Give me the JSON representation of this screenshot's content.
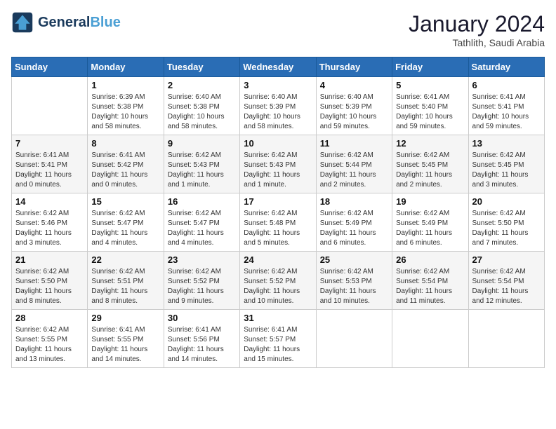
{
  "header": {
    "logo_line1": "General",
    "logo_line2": "Blue",
    "month": "January 2024",
    "location": "Tathlith, Saudi Arabia"
  },
  "weekdays": [
    "Sunday",
    "Monday",
    "Tuesday",
    "Wednesday",
    "Thursday",
    "Friday",
    "Saturday"
  ],
  "weeks": [
    [
      {
        "day": "",
        "info": ""
      },
      {
        "day": "1",
        "info": "Sunrise: 6:39 AM\nSunset: 5:38 PM\nDaylight: 10 hours\nand 58 minutes."
      },
      {
        "day": "2",
        "info": "Sunrise: 6:40 AM\nSunset: 5:38 PM\nDaylight: 10 hours\nand 58 minutes."
      },
      {
        "day": "3",
        "info": "Sunrise: 6:40 AM\nSunset: 5:39 PM\nDaylight: 10 hours\nand 58 minutes."
      },
      {
        "day": "4",
        "info": "Sunrise: 6:40 AM\nSunset: 5:39 PM\nDaylight: 10 hours\nand 59 minutes."
      },
      {
        "day": "5",
        "info": "Sunrise: 6:41 AM\nSunset: 5:40 PM\nDaylight: 10 hours\nand 59 minutes."
      },
      {
        "day": "6",
        "info": "Sunrise: 6:41 AM\nSunset: 5:41 PM\nDaylight: 10 hours\nand 59 minutes."
      }
    ],
    [
      {
        "day": "7",
        "info": "Sunrise: 6:41 AM\nSunset: 5:41 PM\nDaylight: 11 hours\nand 0 minutes."
      },
      {
        "day": "8",
        "info": "Sunrise: 6:41 AM\nSunset: 5:42 PM\nDaylight: 11 hours\nand 0 minutes."
      },
      {
        "day": "9",
        "info": "Sunrise: 6:42 AM\nSunset: 5:43 PM\nDaylight: 11 hours\nand 1 minute."
      },
      {
        "day": "10",
        "info": "Sunrise: 6:42 AM\nSunset: 5:43 PM\nDaylight: 11 hours\nand 1 minute."
      },
      {
        "day": "11",
        "info": "Sunrise: 6:42 AM\nSunset: 5:44 PM\nDaylight: 11 hours\nand 2 minutes."
      },
      {
        "day": "12",
        "info": "Sunrise: 6:42 AM\nSunset: 5:45 PM\nDaylight: 11 hours\nand 2 minutes."
      },
      {
        "day": "13",
        "info": "Sunrise: 6:42 AM\nSunset: 5:45 PM\nDaylight: 11 hours\nand 3 minutes."
      }
    ],
    [
      {
        "day": "14",
        "info": "Sunrise: 6:42 AM\nSunset: 5:46 PM\nDaylight: 11 hours\nand 3 minutes."
      },
      {
        "day": "15",
        "info": "Sunrise: 6:42 AM\nSunset: 5:47 PM\nDaylight: 11 hours\nand 4 minutes."
      },
      {
        "day": "16",
        "info": "Sunrise: 6:42 AM\nSunset: 5:47 PM\nDaylight: 11 hours\nand 4 minutes."
      },
      {
        "day": "17",
        "info": "Sunrise: 6:42 AM\nSunset: 5:48 PM\nDaylight: 11 hours\nand 5 minutes."
      },
      {
        "day": "18",
        "info": "Sunrise: 6:42 AM\nSunset: 5:49 PM\nDaylight: 11 hours\nand 6 minutes."
      },
      {
        "day": "19",
        "info": "Sunrise: 6:42 AM\nSunset: 5:49 PM\nDaylight: 11 hours\nand 6 minutes."
      },
      {
        "day": "20",
        "info": "Sunrise: 6:42 AM\nSunset: 5:50 PM\nDaylight: 11 hours\nand 7 minutes."
      }
    ],
    [
      {
        "day": "21",
        "info": "Sunrise: 6:42 AM\nSunset: 5:50 PM\nDaylight: 11 hours\nand 8 minutes."
      },
      {
        "day": "22",
        "info": "Sunrise: 6:42 AM\nSunset: 5:51 PM\nDaylight: 11 hours\nand 8 minutes."
      },
      {
        "day": "23",
        "info": "Sunrise: 6:42 AM\nSunset: 5:52 PM\nDaylight: 11 hours\nand 9 minutes."
      },
      {
        "day": "24",
        "info": "Sunrise: 6:42 AM\nSunset: 5:52 PM\nDaylight: 11 hours\nand 10 minutes."
      },
      {
        "day": "25",
        "info": "Sunrise: 6:42 AM\nSunset: 5:53 PM\nDaylight: 11 hours\nand 10 minutes."
      },
      {
        "day": "26",
        "info": "Sunrise: 6:42 AM\nSunset: 5:54 PM\nDaylight: 11 hours\nand 11 minutes."
      },
      {
        "day": "27",
        "info": "Sunrise: 6:42 AM\nSunset: 5:54 PM\nDaylight: 11 hours\nand 12 minutes."
      }
    ],
    [
      {
        "day": "28",
        "info": "Sunrise: 6:42 AM\nSunset: 5:55 PM\nDaylight: 11 hours\nand 13 minutes."
      },
      {
        "day": "29",
        "info": "Sunrise: 6:41 AM\nSunset: 5:55 PM\nDaylight: 11 hours\nand 14 minutes."
      },
      {
        "day": "30",
        "info": "Sunrise: 6:41 AM\nSunset: 5:56 PM\nDaylight: 11 hours\nand 14 minutes."
      },
      {
        "day": "31",
        "info": "Sunrise: 6:41 AM\nSunset: 5:57 PM\nDaylight: 11 hours\nand 15 minutes."
      },
      {
        "day": "",
        "info": ""
      },
      {
        "day": "",
        "info": ""
      },
      {
        "day": "",
        "info": ""
      }
    ]
  ]
}
